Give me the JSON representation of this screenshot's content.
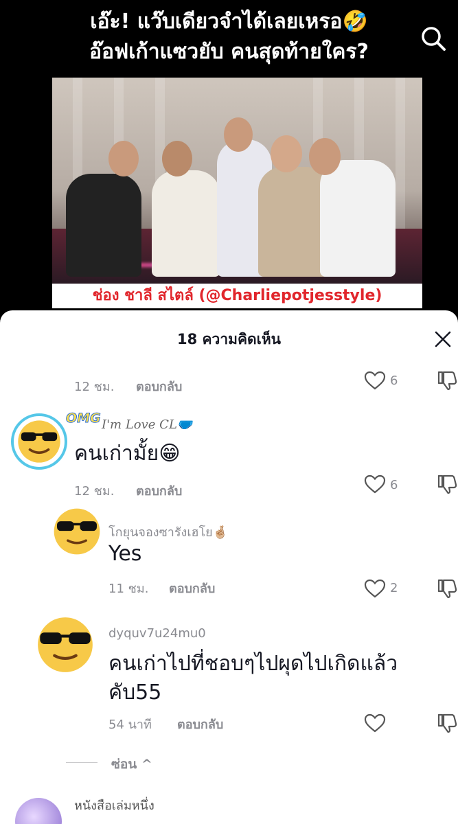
{
  "video": {
    "title_line1": "เอ๊ะ! แว๊บเดียวจำได้เลยเหรอ🤣",
    "title_line2": "อ๊อฟเก้าแซวยับ คนสุดท้ายใคร?",
    "channel_banner": "ช่อง ชาลี สไตล์ (@Charliepotjesstyle)"
  },
  "sheet": {
    "title": "18 ความคิดเห็น"
  },
  "comments": [
    {
      "time": "12 ชม.",
      "reply_label": "ตอบกลับ",
      "likes": "6"
    },
    {
      "username": "I'm Love CL🩲",
      "badge": "OMG",
      "text": "คนเก่ามั้ย😁",
      "time": "12 ชม.",
      "reply_label": "ตอบกลับ",
      "likes": "6"
    },
    {
      "username": "โกยุนจองซารังเฮโย🤞🏼",
      "text": "Yes",
      "time": "11 ชม.",
      "reply_label": "ตอบกลับ",
      "likes": "2"
    },
    {
      "username": "dyquv7u24mu0",
      "text": "คนเก่าไปที่ชอบๆไปผุดไปเกิดแล้วคับ55",
      "time": "54 นาที",
      "reply_label": "ตอบกลับ",
      "likes": ""
    },
    {
      "username": "หนังสือเล่มหนึ่ง"
    }
  ],
  "hide_label": "ซ่อน ^",
  "icons": {
    "search": "search-icon",
    "close": "close-icon",
    "like": "heart-outline-icon",
    "dislike": "thumbs-down-icon"
  },
  "colors": {
    "banner_text": "#e1262c",
    "secondary_text": "#8a8b91",
    "primary_text": "#161823"
  }
}
